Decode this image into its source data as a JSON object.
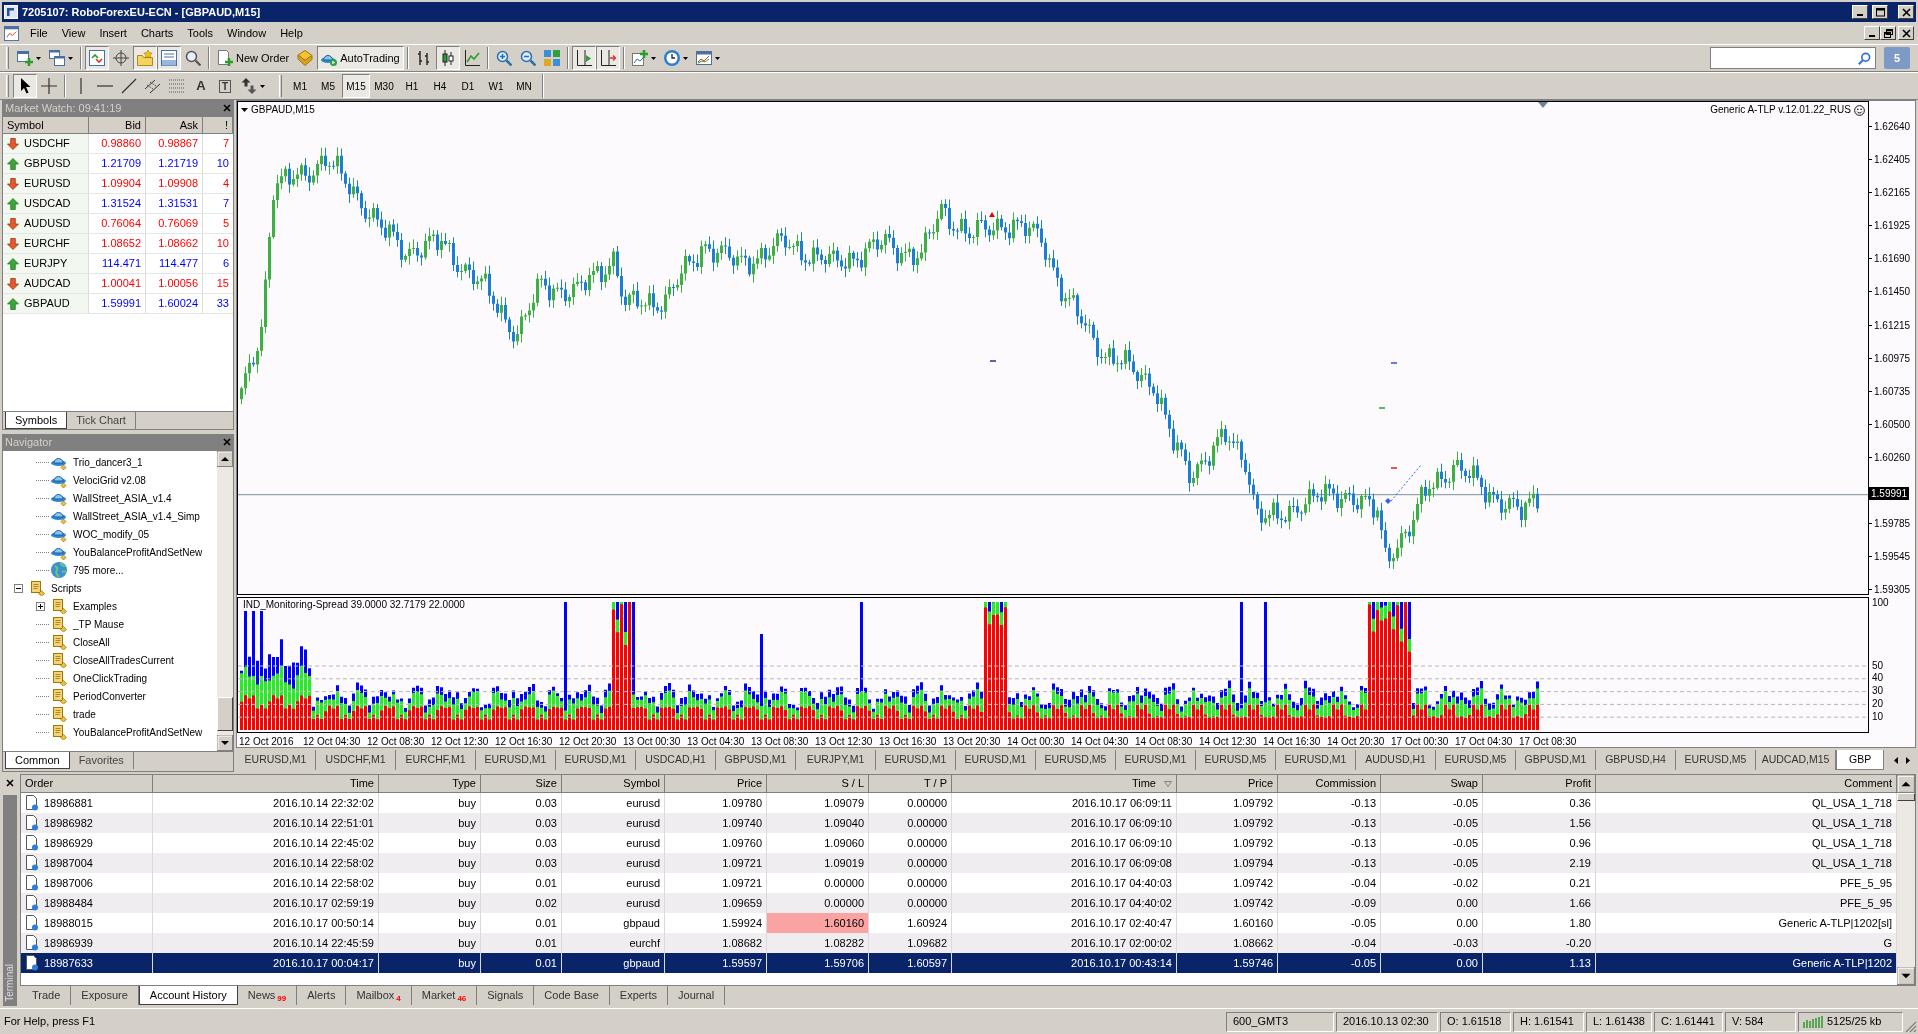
{
  "window": {
    "title": "7205107: RoboForexEU-ECN - [GBPAUD,M15]"
  },
  "menu": [
    "File",
    "View",
    "Insert",
    "Charts",
    "Tools",
    "Window",
    "Help"
  ],
  "toolbar": [
    {
      "kind": "new-chart",
      "pressed": false,
      "menu": true
    },
    {
      "kind": "profiles",
      "pressed": false,
      "menu": true
    },
    {
      "kind": "separator"
    },
    {
      "kind": "market-watch",
      "pressed": true
    },
    {
      "kind": "data-window",
      "pressed": false
    },
    {
      "kind": "navigator",
      "pressed": true
    },
    {
      "kind": "terminal",
      "pressed": true
    },
    {
      "kind": "tester",
      "pressed": false
    },
    {
      "kind": "separator"
    },
    {
      "kind": "new-order",
      "label": "New Order",
      "pressed": false
    },
    {
      "kind": "editor",
      "pressed": false
    },
    {
      "kind": "autotrading",
      "label": "AutoTrading",
      "pressed": true
    },
    {
      "kind": "separator"
    },
    {
      "kind": "bars",
      "pressed": false
    },
    {
      "kind": "candles",
      "pressed": true
    },
    {
      "kind": "line",
      "pressed": false
    },
    {
      "kind": "separator"
    },
    {
      "kind": "zoom-in",
      "pressed": false
    },
    {
      "kind": "zoom-out",
      "pressed": false
    },
    {
      "kind": "tile",
      "pressed": false
    },
    {
      "kind": "separator"
    },
    {
      "kind": "auto-scroll",
      "pressed": true
    },
    {
      "kind": "chart-shift",
      "pressed": true
    },
    {
      "kind": "separator"
    },
    {
      "kind": "indicators",
      "pressed": false,
      "menu": true
    },
    {
      "kind": "periods",
      "pressed": false,
      "menu": true
    },
    {
      "kind": "templates",
      "pressed": false,
      "menu": true
    }
  ],
  "chat_count": "5",
  "drawing_tools": [
    {
      "kind": "cursor",
      "pressed": true
    },
    {
      "kind": "crosshair",
      "pressed": false
    },
    {
      "kind": "separator"
    },
    {
      "kind": "vertical-line",
      "pressed": false
    },
    {
      "kind": "horizontal-line",
      "pressed": false
    },
    {
      "kind": "trend-line",
      "pressed": false
    },
    {
      "kind": "channel",
      "pressed": false
    },
    {
      "kind": "fibonacci",
      "pressed": false
    },
    {
      "kind": "text-tool",
      "glyph": "A",
      "pressed": false
    },
    {
      "kind": "label-tool",
      "glyph": "T",
      "pressed": false
    },
    {
      "kind": "arrows",
      "pressed": false,
      "menu": true
    }
  ],
  "timeframes": [
    {
      "label": "M1",
      "selected": false
    },
    {
      "label": "M5",
      "selected": false
    },
    {
      "label": "M15",
      "selected": true
    },
    {
      "label": "M30",
      "selected": false
    },
    {
      "label": "H1",
      "selected": false
    },
    {
      "label": "H4",
      "selected": false
    },
    {
      "label": "D1",
      "selected": false
    },
    {
      "label": "W1",
      "selected": false
    },
    {
      "label": "MN",
      "selected": false
    }
  ],
  "market_watch": {
    "title": "Market Watch: 09:41:19",
    "columns": [
      "Symbol",
      "Bid",
      "Ask",
      "!"
    ],
    "rows": [
      {
        "kind": "down",
        "symbol": "USDCHF",
        "bid": "0.98860",
        "ask": "0.98867",
        "spread": "7"
      },
      {
        "kind": "up",
        "symbol": "GBPUSD",
        "bid": "1.21709",
        "ask": "1.21719",
        "spread": "10"
      },
      {
        "kind": "down",
        "symbol": "EURUSD",
        "bid": "1.09904",
        "ask": "1.09908",
        "spread": "4"
      },
      {
        "kind": "up",
        "symbol": "USDCAD",
        "bid": "1.31524",
        "ask": "1.31531",
        "spread": "7"
      },
      {
        "kind": "down",
        "symbol": "AUDUSD",
        "bid": "0.76064",
        "ask": "0.76069",
        "spread": "5"
      },
      {
        "kind": "down",
        "symbol": "EURCHF",
        "bid": "1.08652",
        "ask": "1.08662",
        "spread": "10"
      },
      {
        "kind": "up",
        "symbol": "EURJPY",
        "bid": "114.471",
        "ask": "114.477",
        "spread": "6"
      },
      {
        "kind": "down",
        "symbol": "AUDCAD",
        "bid": "1.00041",
        "ask": "1.00056",
        "spread": "15"
      },
      {
        "kind": "up",
        "symbol": "GBPAUD",
        "bid": "1.59991",
        "ask": "1.60024",
        "spread": "33"
      }
    ],
    "tabs": [
      {
        "label": "Symbols",
        "selected": true
      },
      {
        "label": "Tick Chart",
        "selected": false
      }
    ]
  },
  "navigator": {
    "title": "Navigator",
    "tree": [
      {
        "children": [
          {
            "kind": "expert",
            "label": "Trio_dancer3_1"
          },
          {
            "kind": "expert",
            "label": "VelociGrid v2.08"
          },
          {
            "kind": "expert",
            "label": "WallStreet_ASIA_v1.4"
          },
          {
            "kind": "expert",
            "label": "WallStreet_ASIA_v1.4_Simp"
          },
          {
            "kind": "expert",
            "label": "WOC_modify_05"
          },
          {
            "kind": "expert",
            "label": "YouBalanceProfitAndSetNew"
          },
          {
            "kind": "more",
            "label": "795 more..."
          }
        ]
      },
      {
        "kind": "folder",
        "label": "Scripts",
        "expanded": true,
        "children": [
          {
            "kind": "folder",
            "label": "Examples",
            "expanded": false
          },
          {
            "kind": "script",
            "label": "_TP Mause"
          },
          {
            "kind": "script",
            "label": "CloseAll"
          },
          {
            "kind": "script",
            "label": "CloseAllTradesCurrent"
          },
          {
            "kind": "script",
            "label": "OneClickTrading"
          },
          {
            "kind": "script",
            "label": "PeriodConverter"
          },
          {
            "kind": "script",
            "label": "trade"
          },
          {
            "kind": "script",
            "label": "YouBalanceProfitAndSetNew"
          }
        ]
      }
    ],
    "tabs": [
      {
        "label": "Common",
        "selected": true
      },
      {
        "label": "Favorites",
        "selected": false
      }
    ]
  },
  "chart": {
    "title": "GBPAUD,M15",
    "expert": "Generic A-TLP v.12.01.22_RUS",
    "price_axis": [
      {
        "kind": "tick",
        "label": "1.62640"
      },
      {
        "kind": "tick",
        "label": "1.62405"
      },
      {
        "kind": "tick",
        "label": "1.62165"
      },
      {
        "kind": "tick",
        "label": "1.61925"
      },
      {
        "kind": "tick",
        "label": "1.61690"
      },
      {
        "kind": "tick",
        "label": "1.61450"
      },
      {
        "kind": "tick",
        "label": "1.61215"
      },
      {
        "kind": "tick",
        "label": "1.60975"
      },
      {
        "kind": "tick",
        "label": "1.60735"
      },
      {
        "kind": "tick",
        "label": "1.60500"
      },
      {
        "kind": "tick",
        "label": "1.60260"
      },
      {
        "kind": "current",
        "label": "1.59991"
      },
      {
        "kind": "tick",
        "label": "1.59785"
      },
      {
        "kind": "tick",
        "label": "1.59545"
      },
      {
        "kind": "tick",
        "label": "1.59305"
      }
    ],
    "indicator": {
      "title": "IND_Monitoring-Spread 39.0000 32.7179 22.0000",
      "axis": [
        "100",
        "50",
        "40",
        "30",
        "20",
        "10"
      ]
    },
    "time_axis": [
      "12 Oct 2016",
      "12 Oct 04:30",
      "12 Oct 08:30",
      "12 Oct 12:30",
      "12 Oct 16:30",
      "12 Oct 20:30",
      "13 Oct 00:30",
      "13 Oct 04:30",
      "13 Oct 08:30",
      "13 Oct 12:30",
      "13 Oct 16:30",
      "13 Oct 20:30",
      "14 Oct 00:30",
      "14 Oct 04:30",
      "14 Oct 08:30",
      "14 Oct 12:30",
      "14 Oct 16:30",
      "14 Oct 20:30",
      "17 Oct 00:30",
      "17 Oct 04:30",
      "17 Oct 08:30"
    ]
  },
  "chart_tabs": [
    {
      "label": "EURUSD,M1",
      "selected": false
    },
    {
      "label": "USDCHF,M1",
      "selected": false
    },
    {
      "label": "EURCHF,M1",
      "selected": false
    },
    {
      "label": "EURUSD,M1",
      "selected": false
    },
    {
      "label": "EURUSD,M1",
      "selected": false
    },
    {
      "label": "USDCAD,H1",
      "selected": false
    },
    {
      "label": "GBPUSD,M1",
      "selected": false
    },
    {
      "label": "EURJPY,M1",
      "selected": false
    },
    {
      "label": "EURUSD,M1",
      "selected": false
    },
    {
      "label": "EURUSD,M1",
      "selected": false
    },
    {
      "label": "EURUSD,M5",
      "selected": false
    },
    {
      "label": "EURUSD,M1",
      "selected": false
    },
    {
      "label": "EURUSD,M5",
      "selected": false
    },
    {
      "label": "EURUSD,M1",
      "selected": false
    },
    {
      "label": "AUDUSD,H1",
      "selected": false
    },
    {
      "label": "EURUSD,M5",
      "selected": false
    },
    {
      "label": "GBPUSD,M1",
      "selected": false
    },
    {
      "label": "GBPUSD,H4",
      "selected": false
    },
    {
      "label": "EURUSD,M5",
      "selected": false
    },
    {
      "label": "AUDCAD,M15",
      "selected": false
    },
    {
      "label": "GBP",
      "selected": true
    }
  ],
  "terminal": {
    "title": "Terminal",
    "columns": [
      {
        "label": "Order",
        "sorted": false
      },
      {
        "label": "Time",
        "sorted": false
      },
      {
        "label": "Type",
        "sorted": false
      },
      {
        "label": "Size",
        "sorted": false
      },
      {
        "label": "Symbol",
        "sorted": false
      },
      {
        "label": "Price",
        "sorted": false
      },
      {
        "label": "S / L",
        "sorted": false
      },
      {
        "label": "T / P",
        "sorted": false
      },
      {
        "label": "Time",
        "sorted": true
      },
      {
        "label": "Price",
        "sorted": false
      },
      {
        "label": "Commission",
        "sorted": false
      },
      {
        "label": "Swap",
        "sorted": false
      },
      {
        "label": "Profit",
        "sorted": false
      },
      {
        "label": "Comment",
        "sorted": false
      }
    ],
    "rows": [
      {
        "selected": false,
        "sl_highlight": false,
        "cells": [
          "18986881",
          "2016.10.14 22:32:02",
          "buy",
          "0.03",
          "eurusd",
          "1.09780",
          "1.09079",
          "0.00000",
          "2016.10.17 06:09:11",
          "1.09792",
          "-0.13",
          "-0.05",
          "0.36",
          "QL_USA_1_718"
        ]
      },
      {
        "selected": false,
        "sl_highlight": false,
        "cells": [
          "18986982",
          "2016.10.14 22:51:01",
          "buy",
          "0.03",
          "eurusd",
          "1.09740",
          "1.09040",
          "0.00000",
          "2016.10.17 06:09:10",
          "1.09792",
          "-0.13",
          "-0.05",
          "1.56",
          "QL_USA_1_718"
        ]
      },
      {
        "selected": false,
        "sl_highlight": false,
        "cells": [
          "18986929",
          "2016.10.14 22:45:02",
          "buy",
          "0.03",
          "eurusd",
          "1.09760",
          "1.09060",
          "0.00000",
          "2016.10.17 06:09:10",
          "1.09792",
          "-0.13",
          "-0.05",
          "0.96",
          "QL_USA_1_718"
        ]
      },
      {
        "selected": false,
        "sl_highlight": false,
        "cells": [
          "18987004",
          "2016.10.14 22:58:02",
          "buy",
          "0.03",
          "eurusd",
          "1.09721",
          "1.09019",
          "0.00000",
          "2016.10.17 06:09:08",
          "1.09794",
          "-0.13",
          "-0.05",
          "2.19",
          "QL_USA_1_718"
        ]
      },
      {
        "selected": false,
        "sl_highlight": false,
        "cells": [
          "18987006",
          "2016.10.14 22:58:02",
          "buy",
          "0.01",
          "eurusd",
          "1.09721",
          "0.00000",
          "0.00000",
          "2016.10.17 04:40:03",
          "1.09742",
          "-0.04",
          "-0.02",
          "0.21",
          "PFE_5_95"
        ]
      },
      {
        "selected": false,
        "sl_highlight": false,
        "cells": [
          "18988484",
          "2016.10.17 02:59:19",
          "buy",
          "0.02",
          "eurusd",
          "1.09659",
          "0.00000",
          "0.00000",
          "2016.10.17 04:40:02",
          "1.09742",
          "-0.09",
          "0.00",
          "1.66",
          "PFE_5_95"
        ]
      },
      {
        "selected": false,
        "sl_highlight": true,
        "cells": [
          "18988015",
          "2016.10.17 00:50:14",
          "buy",
          "0.01",
          "gbpaud",
          "1.59924",
          "1.60160",
          "1.60924",
          "2016.10.17 02:40:47",
          "1.60160",
          "-0.05",
          "0.00",
          "1.80",
          "Generic A-TLP|1202[sl]"
        ]
      },
      {
        "selected": false,
        "sl_highlight": false,
        "cells": [
          "18986939",
          "2016.10.14 22:45:59",
          "buy",
          "0.01",
          "eurchf",
          "1.08682",
          "1.08282",
          "1.09682",
          "2016.10.17 02:00:02",
          "1.08662",
          "-0.04",
          "-0.03",
          "-0.20",
          "G"
        ]
      },
      {
        "selected": true,
        "sl_highlight": false,
        "cells": [
          "18987633",
          "2016.10.17 00:04:17",
          "buy",
          "0.01",
          "gbpaud",
          "1.59597",
          "1.59706",
          "1.60597",
          "2016.10.17 00:43:14",
          "1.59746",
          "-0.05",
          "0.00",
          "1.13",
          "Generic A-TLP|1202"
        ]
      }
    ],
    "tabs": [
      {
        "label": "Trade",
        "selected": false
      },
      {
        "label": "Exposure",
        "selected": false
      },
      {
        "label": "Account History",
        "selected": true
      },
      {
        "label": "News",
        "badge": "99",
        "selected": false
      },
      {
        "label": "Alerts",
        "selected": false
      },
      {
        "label": "Mailbox",
        "badge": "4",
        "selected": false
      },
      {
        "label": "Market",
        "badge": "46",
        "selected": false
      },
      {
        "label": "Signals",
        "selected": false
      },
      {
        "label": "Code Base",
        "selected": false
      },
      {
        "label": "Experts",
        "selected": false
      },
      {
        "label": "Journal",
        "selected": false
      }
    ]
  },
  "status_bar": {
    "help": "For Help, press F1",
    "fields": [
      "600_GMT3",
      "2016.10.13 02:30",
      "O: 1.61518",
      "H: 1.61541",
      "L: 1.61438",
      "C: 1.61441",
      "V: 584"
    ],
    "traffic": "5125/25 kb"
  }
}
